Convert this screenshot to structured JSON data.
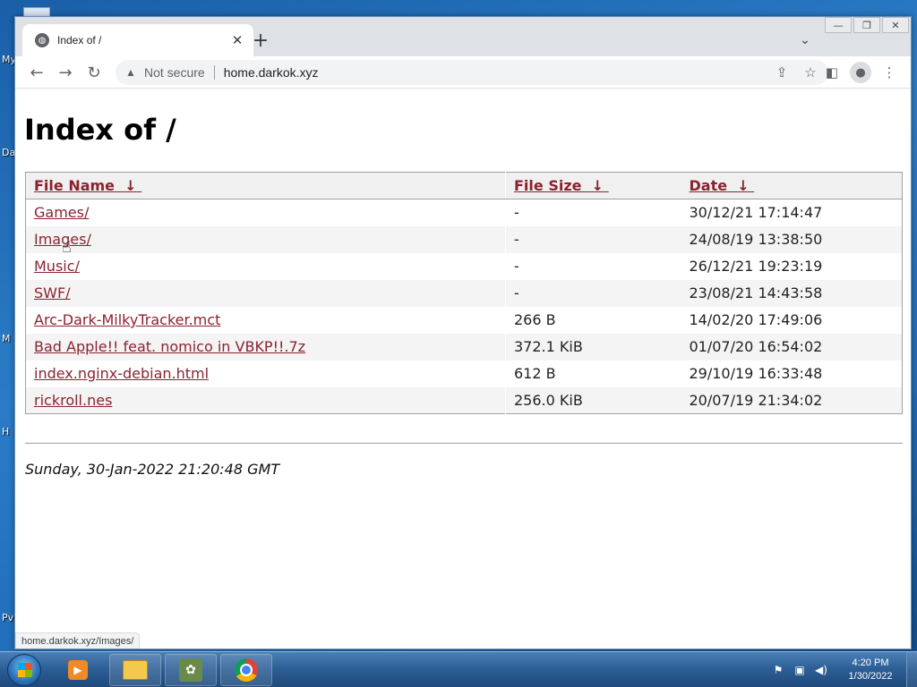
{
  "desktop": {
    "icon_fragments": [
      "My",
      "Da",
      "M",
      "H",
      "Pv"
    ]
  },
  "browser": {
    "tab": {
      "title": "Index of /",
      "favicon": "globe-icon"
    },
    "address": {
      "security_label": "Not secure",
      "url": "home.darkok.xyz"
    },
    "status_url": "home.darkok.xyz/Images/"
  },
  "page": {
    "title": "Index of /",
    "columns": {
      "name": "File Name",
      "size": "File Size",
      "date": "Date",
      "sort_arrow": "↓"
    },
    "rows": [
      {
        "name": "Games/",
        "size": "-",
        "date": "30/12/21 17:14:47"
      },
      {
        "name": "Images/",
        "size": "-",
        "date": "24/08/19 13:38:50"
      },
      {
        "name": "Music/",
        "size": "-",
        "date": "26/12/21 19:23:19"
      },
      {
        "name": "SWF/",
        "size": "-",
        "date": "23/08/21 14:43:58"
      },
      {
        "name": "Arc-Dark-MilkyTracker.mct",
        "size": "266 B",
        "date": "14/02/20 17:49:06"
      },
      {
        "name": "Bad Apple!! feat. nomico in VBKP!!.7z",
        "size": "372.1 KiB",
        "date": "01/07/20 16:54:02"
      },
      {
        "name": "index.nginx-debian.html",
        "size": "612 B",
        "date": "29/10/19 16:33:48"
      },
      {
        "name": "rickroll.nes",
        "size": "256.0 KiB",
        "date": "20/07/19 21:34:02"
      }
    ],
    "footer_time": "Sunday, 30-Jan-2022 21:20:48 GMT"
  },
  "taskbar": {
    "clock_time": "4:20 PM",
    "clock_date": "1/30/2022"
  },
  "colors": {
    "link": "#8a2330",
    "taskbar": "#2c5d94"
  }
}
